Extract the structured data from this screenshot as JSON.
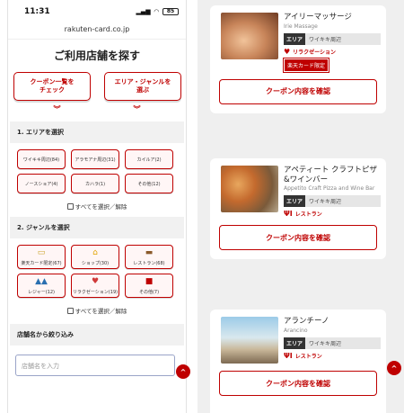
{
  "left": {
    "status": {
      "time": "11:31",
      "battery": "85"
    },
    "url": "rakuten-card.co.jp",
    "title": "ご利用店舗を探す",
    "buttons": [
      {
        "label": "クーポン一覧を\nチェック"
      },
      {
        "label": "エリア・ジャンルを\n選ぶ"
      }
    ],
    "chevron": "︾",
    "area_section": {
      "heading": "1. エリアを選択",
      "options": [
        "ワイキキ周辺(84)",
        "アラモアナ周辺(31)",
        "カイルア(2)",
        "ノースショア(4)",
        "カハラ(1)",
        "その他(12)"
      ],
      "select_all": "すべてを選択／解除"
    },
    "genre_section": {
      "heading": "2. ジャンルを選択",
      "options": [
        {
          "label": "楽天カード限定(67)",
          "icon": "card-icon"
        },
        {
          "label": "ショップ(30)",
          "icon": "shop-icon"
        },
        {
          "label": "レストラン(68)",
          "icon": "restaurant-icon"
        },
        {
          "label": "レジャー(12)",
          "icon": "leisure-icon"
        },
        {
          "label": "リラクゼーション(19)",
          "icon": "relaxation-icon"
        },
        {
          "label": "その他(7)",
          "icon": "gift-icon"
        }
      ],
      "select_all": "すべてを選択／解除"
    },
    "name_section": {
      "heading": "店舗名から絞り込み",
      "placeholder": "店舗名を入力"
    },
    "fab": "^"
  },
  "right": {
    "shops": [
      {
        "name": "アイリーマッサージ",
        "en": "Irie Massage",
        "area_label": "エリア",
        "area": "ワイキキ周辺",
        "genre": "リラクゼーション",
        "genre_icon": "heart-icon",
        "badge": "楽天カード限定",
        "button": "クーポン内容を確認"
      },
      {
        "name": "アペティート クラフトピザ&ワインバー",
        "en": "Appetito Craft Pizza and Wine Bar",
        "area_label": "エリア",
        "area": "ワイキキ周辺",
        "genre": "レストラン",
        "genre_icon": "fork-knife-icon",
        "button": "クーポン内容を確認"
      },
      {
        "name": "アランチーノ",
        "en": "Arancino",
        "area_label": "エリア",
        "area": "ワイキキ周辺",
        "genre": "レストラン",
        "genre_icon": "fork-knife-icon",
        "button": "クーポン内容を確認"
      }
    ],
    "fab": "^"
  },
  "colors": {
    "accent": "#bf0000",
    "chip_bg": "#fff6f6",
    "panel_bg": "#efefef"
  }
}
